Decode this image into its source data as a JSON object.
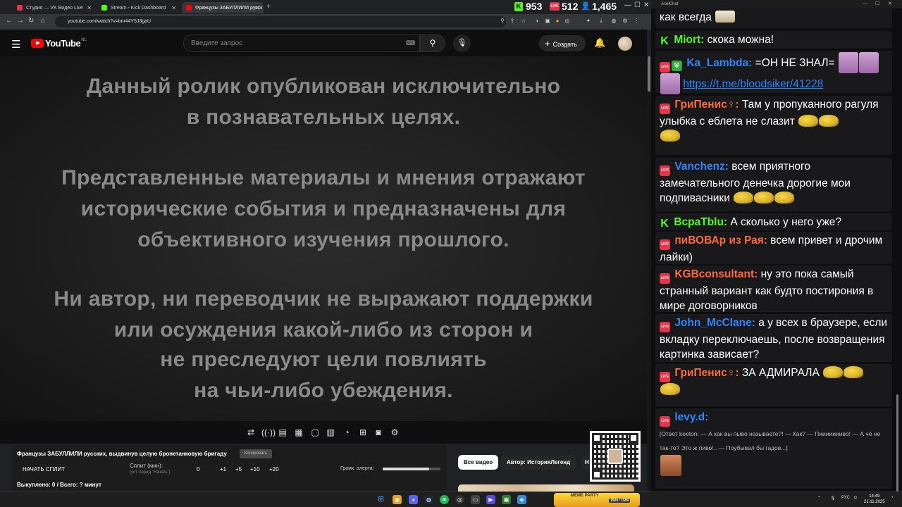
{
  "browser": {
    "tabs": [
      {
        "label": "Студия — VK Видео Live",
        "color": "#e8344a"
      },
      {
        "label": "Stream - Kick Dashboard",
        "color": "#53fc18"
      },
      {
        "label": "Французы ЗАБУЛЛИЛИ русск",
        "color": "#ff0000"
      }
    ],
    "url": "youtube.com/watch?v=bm44Y5J3gaU"
  },
  "counters": {
    "kick": "953",
    "vk": "512",
    "viewers": "1,465"
  },
  "youtube": {
    "logo_text": "YouTube",
    "region": "NL",
    "search_placeholder": "Введите запрос",
    "create_label": "Создать"
  },
  "video": {
    "lines": [
      "Данный ролик опубликован исключительно",
      "в познавательных целях.",
      "Представленные материалы и мнения отражают",
      "исторические события и предназначены для",
      "объективного изучения прошлого.",
      "Ни автор, ни переводчик не выражают поддержки",
      "или осуждения какой-либо из сторон и",
      "не преследуют цели повлиять",
      "на чьи-либо убеждения."
    ]
  },
  "split": {
    "title": "Французы ЗАБУЛЛИЛИ русских, выдвинув целую бронетанковую бригаду",
    "copy_label": "Копировать",
    "start_label": "НАЧАТЬ СПЛИТ",
    "split_label": "Сплит (мин):",
    "split_hint": "(уст. перед \"Начать\")",
    "value": "0",
    "steps": [
      "+1",
      "+5",
      "+10",
      "+20"
    ],
    "alert_label": "Громк. алерта:",
    "alert_level": 0.8,
    "footer": "Выкуплено: 0 / Всего: ? минут"
  },
  "chips": [
    {
      "label": "Все видео",
      "active": true
    },
    {
      "label": "Автор: ИсторияЛегенд",
      "active": false
    },
    {
      "label": "Н",
      "active": false
    }
  ],
  "chat": {
    "window_title": "AxelChat",
    "messages": [
      {
        "text": "как всегда"
      },
      {
        "platform": "kick",
        "user": "Miort:",
        "color": "#53fc18",
        "text": "скока можна!"
      },
      {
        "platform": "live",
        "user": "Ka_Lambda:",
        "color": "#2e86ff",
        "text": "=ОН НЕ ЗНАЛ=",
        "link": "https://t.me/bloodsiker/41228"
      },
      {
        "platform": "live",
        "user": "ГриПенис♀:",
        "color": "#ff6a3d",
        "text": "Там у пропуканного рагуля улыбка с еблета не слазит"
      },
      {
        "platform": "live",
        "user": "Vanchenz:",
        "color": "#2e86ff",
        "text": "всем приятного замечательного денечка дорогие мои подпивасники"
      },
      {
        "platform": "kick",
        "user": "ВсраТblu:",
        "color": "#53fc18",
        "text": "А сколько у него уже?"
      },
      {
        "platform": "live",
        "user": "пиВОВАр из Рая:",
        "color": "#ff6a3d",
        "text": "всем привет и дрочим лайки)"
      },
      {
        "platform": "live",
        "user": "KGBconsultant:",
        "color": "#ff6a3d",
        "text": "ну это пока самый странный вариант как будто постирония в мире договорников"
      },
      {
        "platform": "live",
        "user": "John_McClane:",
        "color": "#2e86ff",
        "text": "а у всех в браузере, если вкладку переключаешь, после возвращения картинка зависает?"
      },
      {
        "platform": "live",
        "user": "ГриПенис♀:",
        "color": "#ff6a3d",
        "text": "ЗА АДМИРАЛА"
      },
      {
        "platform": "live",
        "user": "levy.d:",
        "color": "#2e86ff",
        "reply": "[Ответ keeton: — А как вы пыво называете?! — Как? — Пиииииииво! — А чё не так-то? Это ж пиво!.. — Поубывал бы гадов...]"
      }
    ]
  },
  "taskbar": {
    "meme_party": "MEME PARTY",
    "meme_count": "1500 / 1500",
    "lang": "РУС",
    "time": "14:49",
    "date": "21.11.2025"
  }
}
